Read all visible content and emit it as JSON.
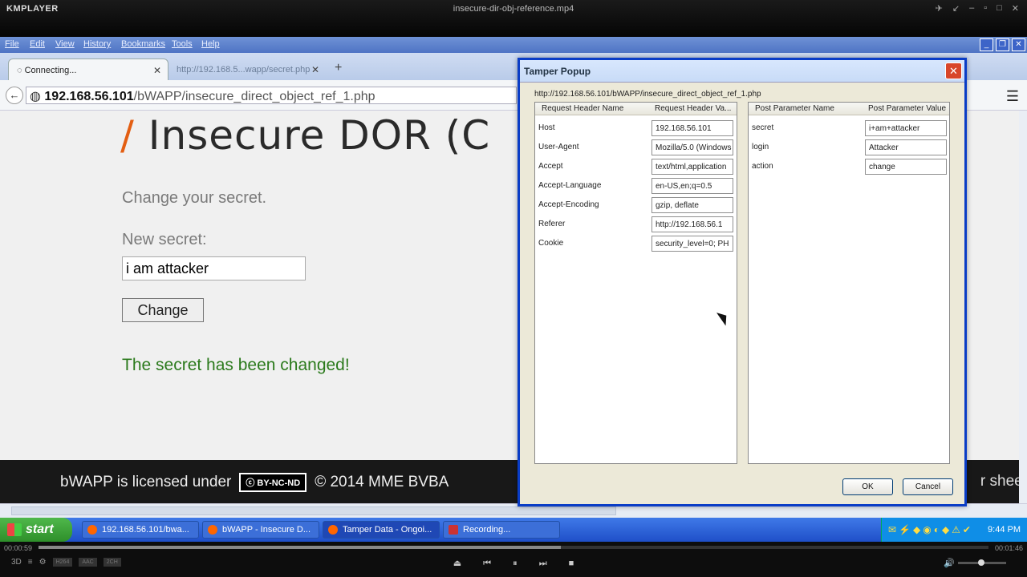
{
  "player": {
    "logo": "KMPLAYER",
    "file_title": "insecure-dir-obj-reference.mp4",
    "elapsed": "00:00:59",
    "total": "00:01:46",
    "progress": 0.55,
    "badges": [
      "H264",
      "AAC",
      "2CH"
    ]
  },
  "browser": {
    "menu": [
      "File",
      "Edit",
      "View",
      "History",
      "Bookmarks",
      "Tools",
      "Help"
    ],
    "tabs": [
      {
        "label": "Connecting..."
      },
      {
        "label": "http://192.168.5...wapp/secret.php"
      }
    ],
    "url_host": "192.168.56.101",
    "url_path": "/bWAPP/insecure_direct_object_ref_1.php"
  },
  "page": {
    "title_slash": "/",
    "title": "Insecure DOR (C",
    "change_label": "Change your secret.",
    "new_secret_label": "New secret:",
    "secret_value": "i am attacker",
    "change_button": "Change",
    "success_msg": "The secret has been changed!",
    "footer_text": "bWAPP is licensed under",
    "footer_badge": "BY-NC-ND",
    "footer_copy": "© 2014 MME BVBA",
    "footer_right": "r sheet"
  },
  "tamper": {
    "title": "Tamper Popup",
    "url": "http://192.168.56.101/bWAPP/insecure_direct_object_ref_1.php",
    "headers_col1": "Request Header Name",
    "headers_col2": "Request Header Va...",
    "headers": [
      {
        "name": "Host",
        "value": "192.168.56.101"
      },
      {
        "name": "User-Agent",
        "value": "Mozilla/5.0 (Windows"
      },
      {
        "name": "Accept",
        "value": "text/html,application"
      },
      {
        "name": "Accept-Language",
        "value": "en-US,en;q=0.5"
      },
      {
        "name": "Accept-Encoding",
        "value": "gzip, deflate"
      },
      {
        "name": "Referer",
        "value": "http://192.168.56.1"
      },
      {
        "name": "Cookie",
        "value": "security_level=0; PH"
      }
    ],
    "params_col1": "Post Parameter Name",
    "params_col2": "Post Parameter Value",
    "params": [
      {
        "name": "secret",
        "value": "i+am+attacker"
      },
      {
        "name": "login",
        "value": "Attacker"
      },
      {
        "name": "action",
        "value": "change"
      }
    ],
    "ok": "OK",
    "cancel": "Cancel"
  },
  "taskbar": {
    "start": "start",
    "tasks": [
      "192.168.56.101/bwa...",
      "bWAPP - Insecure D...",
      "Tamper Data - Ongoi...",
      "Recording..."
    ],
    "clock": "9:44 PM"
  }
}
